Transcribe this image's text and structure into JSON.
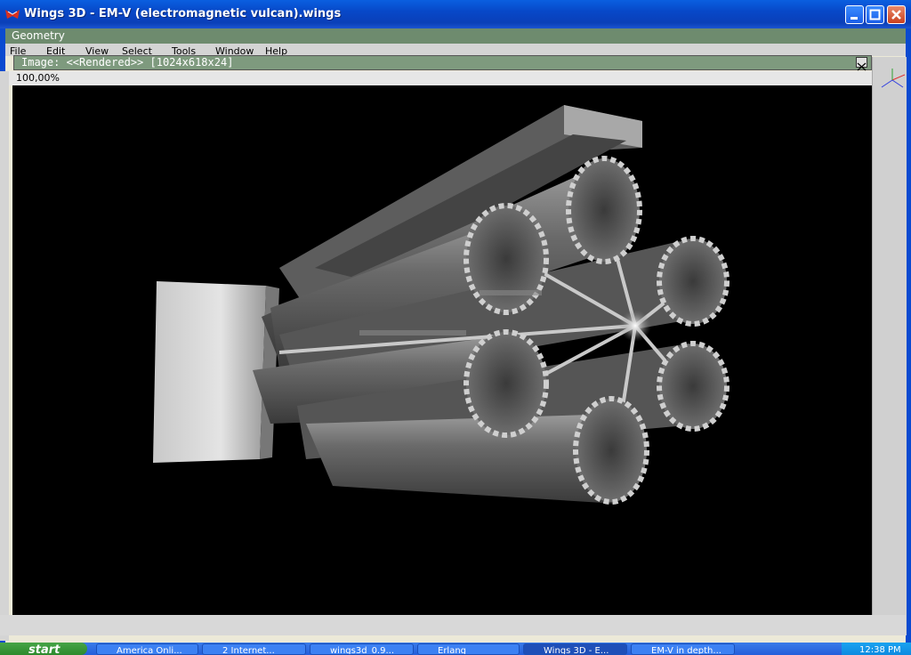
{
  "window": {
    "title": "Wings 3D - EM-V (electromagnetic vulcan).wings"
  },
  "geometry": {
    "title": "Geometry"
  },
  "menu": [
    "File",
    "Edit",
    "View",
    "Select",
    "Tools",
    "Window",
    "Help"
  ],
  "image_window": {
    "title": "Image: <<Rendered>> [1024x618x24]",
    "zoom": "100,00%"
  },
  "taskbar": {
    "start": "start",
    "tasks": [
      "America Onli...",
      "2 Internet...",
      "wings3d_0.9...",
      "Erlang",
      "Wings 3D - E...",
      "EM-V in depth..."
    ],
    "clock": "12:38 PM"
  }
}
